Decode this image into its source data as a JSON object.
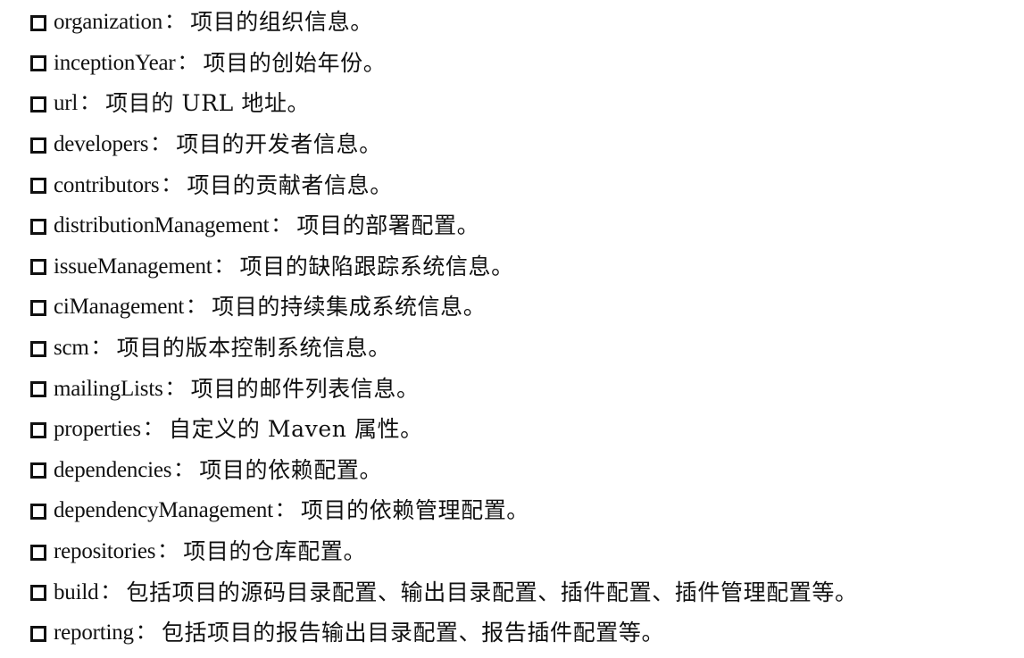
{
  "items": [
    {
      "term": "organization",
      "desc": "项目的组织信息。"
    },
    {
      "term": "inceptionYear",
      "desc": "项目的创始年份。"
    },
    {
      "term": "url",
      "desc": "项目的 URL 地址。"
    },
    {
      "term": "developers",
      "desc": "项目的开发者信息。"
    },
    {
      "term": "contributors",
      "desc": "项目的贡献者信息。"
    },
    {
      "term": "distributionManagement",
      "desc": "项目的部署配置。"
    },
    {
      "term": "issueManagement",
      "desc": "项目的缺陷跟踪系统信息。"
    },
    {
      "term": "ciManagement",
      "desc": "项目的持续集成系统信息。"
    },
    {
      "term": "scm",
      "desc": "项目的版本控制系统信息。"
    },
    {
      "term": "mailingLists",
      "desc": "项目的邮件列表信息。"
    },
    {
      "term": "properties",
      "desc": "自定义的 Maven 属性。"
    },
    {
      "term": "dependencies",
      "desc": "项目的依赖配置。"
    },
    {
      "term": "dependencyManagement",
      "desc": "项目的依赖管理配置。"
    },
    {
      "term": "repositories",
      "desc": "项目的仓库配置。"
    },
    {
      "term": "build",
      "desc": "包括项目的源码目录配置、输出目录配置、插件配置、插件管理配置等。"
    },
    {
      "term": "reporting",
      "desc": "包括项目的报告输出目录配置、报告插件配置等。"
    }
  ],
  "separator": "："
}
